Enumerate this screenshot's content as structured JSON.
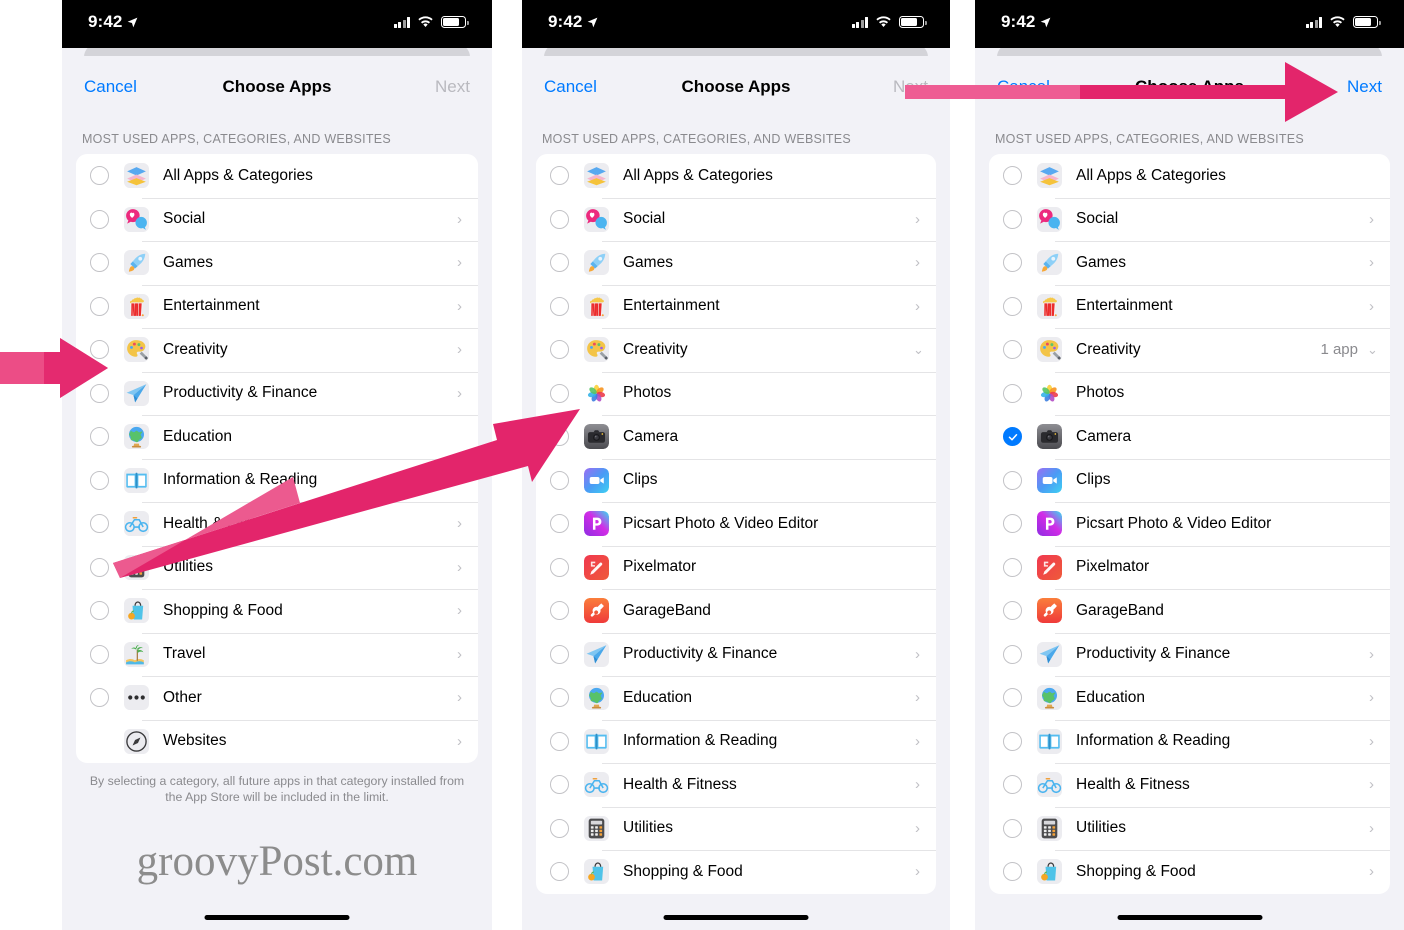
{
  "status_bar": {
    "time": "9:42",
    "location_icon": "location-arrow-icon",
    "signal_icon": "cellular-signal-icon",
    "wifi_icon": "wifi-icon",
    "battery_icon": "battery-icon"
  },
  "watermark": "groovyPost.com",
  "colors": {
    "accent_blue": "#007aff",
    "arrow_pink": "#e3256b",
    "sheet_bg": "#f2f2f7",
    "card_bg": "#ffffff",
    "separator": "#e4e4e6",
    "secondary_text": "#8a8a8e"
  },
  "panels": [
    {
      "id": "panel-1",
      "nav": {
        "cancel_label": "Cancel",
        "title": "Choose Apps",
        "next_label": "Next",
        "next_enabled": false
      },
      "section_header": "MOST USED APPS, CATEGORIES, AND WEBSITES",
      "rows": [
        {
          "label": "All Apps & Categories",
          "icon": "stack-icon",
          "radio": "unchecked",
          "accessory": "none",
          "detail": ""
        },
        {
          "label": "Social",
          "icon": "social-icon",
          "radio": "unchecked",
          "accessory": "chevron-right",
          "detail": ""
        },
        {
          "label": "Games",
          "icon": "rocket-icon",
          "radio": "unchecked",
          "accessory": "chevron-right",
          "detail": ""
        },
        {
          "label": "Entertainment",
          "icon": "popcorn-icon",
          "radio": "unchecked",
          "accessory": "chevron-right",
          "detail": ""
        },
        {
          "label": "Creativity",
          "icon": "palette-icon",
          "radio": "unchecked",
          "accessory": "chevron-right",
          "detail": ""
        },
        {
          "label": "Productivity & Finance",
          "icon": "paper-plane-icon",
          "radio": "unchecked",
          "accessory": "chevron-right",
          "detail": ""
        },
        {
          "label": "Education",
          "icon": "globe-icon",
          "radio": "unchecked",
          "accessory": "none",
          "detail": ""
        },
        {
          "label": "Information & Reading",
          "icon": "open-book-icon",
          "radio": "unchecked",
          "accessory": "chevron-right",
          "detail": ""
        },
        {
          "label": "Health & Fitness",
          "icon": "bicycle-icon",
          "radio": "unchecked",
          "accessory": "chevron-right",
          "detail": ""
        },
        {
          "label": "Utilities",
          "icon": "calculator-icon",
          "radio": "unchecked",
          "accessory": "chevron-right",
          "detail": ""
        },
        {
          "label": "Shopping & Food",
          "icon": "shopping-bag-icon",
          "radio": "unchecked",
          "accessory": "chevron-right",
          "detail": ""
        },
        {
          "label": "Travel",
          "icon": "island-icon",
          "radio": "unchecked",
          "accessory": "chevron-right",
          "detail": ""
        },
        {
          "label": "Other",
          "icon": "ellipsis-icon",
          "radio": "unchecked",
          "accessory": "chevron-right",
          "detail": ""
        },
        {
          "label": "Websites",
          "icon": "compass-icon",
          "radio": "none",
          "accessory": "chevron-right",
          "detail": ""
        }
      ],
      "footnote": "By selecting a category, all future apps in that category installed from the App Store will be included in the limit."
    },
    {
      "id": "panel-2",
      "nav": {
        "cancel_label": "Cancel",
        "title": "Choose Apps",
        "next_label": "Next",
        "next_enabled": false
      },
      "section_header": "MOST USED APPS, CATEGORIES, AND WEBSITES",
      "rows": [
        {
          "label": "All Apps & Categories",
          "icon": "stack-icon",
          "radio": "unchecked",
          "accessory": "none",
          "detail": ""
        },
        {
          "label": "Social",
          "icon": "social-icon",
          "radio": "unchecked",
          "accessory": "chevron-right",
          "detail": ""
        },
        {
          "label": "Games",
          "icon": "rocket-icon",
          "radio": "unchecked",
          "accessory": "chevron-right",
          "detail": ""
        },
        {
          "label": "Entertainment",
          "icon": "popcorn-icon",
          "radio": "unchecked",
          "accessory": "chevron-right",
          "detail": ""
        },
        {
          "label": "Creativity",
          "icon": "palette-icon",
          "radio": "unchecked",
          "accessory": "chevron-down",
          "detail": ""
        },
        {
          "label": "Photos",
          "icon": "photos-app-icon",
          "radio": "unchecked",
          "accessory": "none",
          "detail": ""
        },
        {
          "label": "Camera",
          "icon": "camera-app-icon",
          "radio": "unchecked",
          "accessory": "none",
          "detail": ""
        },
        {
          "label": "Clips",
          "icon": "clips-app-icon",
          "radio": "unchecked",
          "accessory": "none",
          "detail": ""
        },
        {
          "label": "Picsart Photo & Video Editor",
          "icon": "picsart-app-icon",
          "radio": "unchecked",
          "accessory": "none",
          "detail": ""
        },
        {
          "label": "Pixelmator",
          "icon": "pixelmator-app-icon",
          "radio": "unchecked",
          "accessory": "none",
          "detail": ""
        },
        {
          "label": "GarageBand",
          "icon": "garageband-app-icon",
          "radio": "unchecked",
          "accessory": "none",
          "detail": ""
        },
        {
          "label": "Productivity & Finance",
          "icon": "paper-plane-icon",
          "radio": "unchecked",
          "accessory": "chevron-right",
          "detail": ""
        },
        {
          "label": "Education",
          "icon": "globe-icon",
          "radio": "unchecked",
          "accessory": "chevron-right",
          "detail": ""
        },
        {
          "label": "Information & Reading",
          "icon": "open-book-icon",
          "radio": "unchecked",
          "accessory": "chevron-right",
          "detail": ""
        },
        {
          "label": "Health & Fitness",
          "icon": "bicycle-icon",
          "radio": "unchecked",
          "accessory": "chevron-right",
          "detail": ""
        },
        {
          "label": "Utilities",
          "icon": "calculator-icon",
          "radio": "unchecked",
          "accessory": "chevron-right",
          "detail": ""
        },
        {
          "label": "Shopping & Food",
          "icon": "shopping-bag-icon",
          "radio": "unchecked",
          "accessory": "chevron-right",
          "detail": ""
        }
      ],
      "footnote": ""
    },
    {
      "id": "panel-3",
      "nav": {
        "cancel_label": "Cancel",
        "title": "Choose Apps",
        "next_label": "Next",
        "next_enabled": true
      },
      "section_header": "MOST USED APPS, CATEGORIES, AND WEBSITES",
      "rows": [
        {
          "label": "All Apps & Categories",
          "icon": "stack-icon",
          "radio": "unchecked",
          "accessory": "none",
          "detail": ""
        },
        {
          "label": "Social",
          "icon": "social-icon",
          "radio": "unchecked",
          "accessory": "chevron-right",
          "detail": ""
        },
        {
          "label": "Games",
          "icon": "rocket-icon",
          "radio": "unchecked",
          "accessory": "chevron-right",
          "detail": ""
        },
        {
          "label": "Entertainment",
          "icon": "popcorn-icon",
          "radio": "unchecked",
          "accessory": "chevron-right",
          "detail": ""
        },
        {
          "label": "Creativity",
          "icon": "palette-icon",
          "radio": "unchecked",
          "accessory": "chevron-down",
          "detail": "1 app"
        },
        {
          "label": "Photos",
          "icon": "photos-app-icon",
          "radio": "unchecked",
          "accessory": "none",
          "detail": ""
        },
        {
          "label": "Camera",
          "icon": "camera-app-icon",
          "radio": "checked",
          "accessory": "none",
          "detail": ""
        },
        {
          "label": "Clips",
          "icon": "clips-app-icon",
          "radio": "unchecked",
          "accessory": "none",
          "detail": ""
        },
        {
          "label": "Picsart Photo & Video Editor",
          "icon": "picsart-app-icon",
          "radio": "unchecked",
          "accessory": "none",
          "detail": ""
        },
        {
          "label": "Pixelmator",
          "icon": "pixelmator-app-icon",
          "radio": "unchecked",
          "accessory": "none",
          "detail": ""
        },
        {
          "label": "GarageBand",
          "icon": "garageband-app-icon",
          "radio": "unchecked",
          "accessory": "none",
          "detail": ""
        },
        {
          "label": "Productivity & Finance",
          "icon": "paper-plane-icon",
          "radio": "unchecked",
          "accessory": "chevron-right",
          "detail": ""
        },
        {
          "label": "Education",
          "icon": "globe-icon",
          "radio": "unchecked",
          "accessory": "chevron-right",
          "detail": ""
        },
        {
          "label": "Information & Reading",
          "icon": "open-book-icon",
          "radio": "unchecked",
          "accessory": "chevron-right",
          "detail": ""
        },
        {
          "label": "Health & Fitness",
          "icon": "bicycle-icon",
          "radio": "unchecked",
          "accessory": "chevron-right",
          "detail": ""
        },
        {
          "label": "Utilities",
          "icon": "calculator-icon",
          "radio": "unchecked",
          "accessory": "chevron-right",
          "detail": ""
        },
        {
          "label": "Shopping & Food",
          "icon": "shopping-bag-icon",
          "radio": "unchecked",
          "accessory": "chevron-right",
          "detail": ""
        }
      ],
      "footnote": ""
    }
  ],
  "annotations": [
    {
      "name": "arrow-to-creativity-row",
      "direction": "right"
    },
    {
      "name": "arrow-to-photos-row",
      "direction": "up-right"
    },
    {
      "name": "arrow-to-next-button",
      "direction": "right"
    }
  ]
}
